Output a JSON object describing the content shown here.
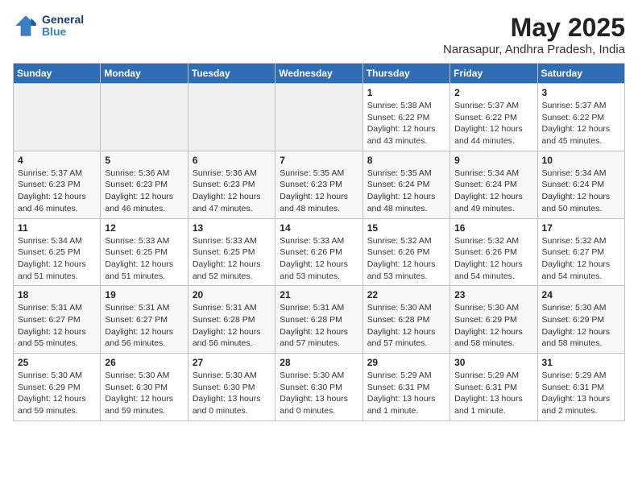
{
  "logo": {
    "line1": "General",
    "line2": "Blue"
  },
  "title": "May 2025",
  "subtitle": "Narasapur, Andhra Pradesh, India",
  "days_of_week": [
    "Sunday",
    "Monday",
    "Tuesday",
    "Wednesday",
    "Thursday",
    "Friday",
    "Saturday"
  ],
  "weeks": [
    [
      {
        "day": "",
        "info": ""
      },
      {
        "day": "",
        "info": ""
      },
      {
        "day": "",
        "info": ""
      },
      {
        "day": "",
        "info": ""
      },
      {
        "day": "1",
        "info": "Sunrise: 5:38 AM\nSunset: 6:22 PM\nDaylight: 12 hours\nand 43 minutes."
      },
      {
        "day": "2",
        "info": "Sunrise: 5:37 AM\nSunset: 6:22 PM\nDaylight: 12 hours\nand 44 minutes."
      },
      {
        "day": "3",
        "info": "Sunrise: 5:37 AM\nSunset: 6:22 PM\nDaylight: 12 hours\nand 45 minutes."
      }
    ],
    [
      {
        "day": "4",
        "info": "Sunrise: 5:37 AM\nSunset: 6:23 PM\nDaylight: 12 hours\nand 46 minutes."
      },
      {
        "day": "5",
        "info": "Sunrise: 5:36 AM\nSunset: 6:23 PM\nDaylight: 12 hours\nand 46 minutes."
      },
      {
        "day": "6",
        "info": "Sunrise: 5:36 AM\nSunset: 6:23 PM\nDaylight: 12 hours\nand 47 minutes."
      },
      {
        "day": "7",
        "info": "Sunrise: 5:35 AM\nSunset: 6:23 PM\nDaylight: 12 hours\nand 48 minutes."
      },
      {
        "day": "8",
        "info": "Sunrise: 5:35 AM\nSunset: 6:24 PM\nDaylight: 12 hours\nand 48 minutes."
      },
      {
        "day": "9",
        "info": "Sunrise: 5:34 AM\nSunset: 6:24 PM\nDaylight: 12 hours\nand 49 minutes."
      },
      {
        "day": "10",
        "info": "Sunrise: 5:34 AM\nSunset: 6:24 PM\nDaylight: 12 hours\nand 50 minutes."
      }
    ],
    [
      {
        "day": "11",
        "info": "Sunrise: 5:34 AM\nSunset: 6:25 PM\nDaylight: 12 hours\nand 51 minutes."
      },
      {
        "day": "12",
        "info": "Sunrise: 5:33 AM\nSunset: 6:25 PM\nDaylight: 12 hours\nand 51 minutes."
      },
      {
        "day": "13",
        "info": "Sunrise: 5:33 AM\nSunset: 6:25 PM\nDaylight: 12 hours\nand 52 minutes."
      },
      {
        "day": "14",
        "info": "Sunrise: 5:33 AM\nSunset: 6:26 PM\nDaylight: 12 hours\nand 53 minutes."
      },
      {
        "day": "15",
        "info": "Sunrise: 5:32 AM\nSunset: 6:26 PM\nDaylight: 12 hours\nand 53 minutes."
      },
      {
        "day": "16",
        "info": "Sunrise: 5:32 AM\nSunset: 6:26 PM\nDaylight: 12 hours\nand 54 minutes."
      },
      {
        "day": "17",
        "info": "Sunrise: 5:32 AM\nSunset: 6:27 PM\nDaylight: 12 hours\nand 54 minutes."
      }
    ],
    [
      {
        "day": "18",
        "info": "Sunrise: 5:31 AM\nSunset: 6:27 PM\nDaylight: 12 hours\nand 55 minutes."
      },
      {
        "day": "19",
        "info": "Sunrise: 5:31 AM\nSunset: 6:27 PM\nDaylight: 12 hours\nand 56 minutes."
      },
      {
        "day": "20",
        "info": "Sunrise: 5:31 AM\nSunset: 6:28 PM\nDaylight: 12 hours\nand 56 minutes."
      },
      {
        "day": "21",
        "info": "Sunrise: 5:31 AM\nSunset: 6:28 PM\nDaylight: 12 hours\nand 57 minutes."
      },
      {
        "day": "22",
        "info": "Sunrise: 5:30 AM\nSunset: 6:28 PM\nDaylight: 12 hours\nand 57 minutes."
      },
      {
        "day": "23",
        "info": "Sunrise: 5:30 AM\nSunset: 6:29 PM\nDaylight: 12 hours\nand 58 minutes."
      },
      {
        "day": "24",
        "info": "Sunrise: 5:30 AM\nSunset: 6:29 PM\nDaylight: 12 hours\nand 58 minutes."
      }
    ],
    [
      {
        "day": "25",
        "info": "Sunrise: 5:30 AM\nSunset: 6:29 PM\nDaylight: 12 hours\nand 59 minutes."
      },
      {
        "day": "26",
        "info": "Sunrise: 5:30 AM\nSunset: 6:30 PM\nDaylight: 12 hours\nand 59 minutes."
      },
      {
        "day": "27",
        "info": "Sunrise: 5:30 AM\nSunset: 6:30 PM\nDaylight: 13 hours\nand 0 minutes."
      },
      {
        "day": "28",
        "info": "Sunrise: 5:30 AM\nSunset: 6:30 PM\nDaylight: 13 hours\nand 0 minutes."
      },
      {
        "day": "29",
        "info": "Sunrise: 5:29 AM\nSunset: 6:31 PM\nDaylight: 13 hours\nand 1 minute."
      },
      {
        "day": "30",
        "info": "Sunrise: 5:29 AM\nSunset: 6:31 PM\nDaylight: 13 hours\nand 1 minute."
      },
      {
        "day": "31",
        "info": "Sunrise: 5:29 AM\nSunset: 6:31 PM\nDaylight: 13 hours\nand 2 minutes."
      }
    ]
  ]
}
